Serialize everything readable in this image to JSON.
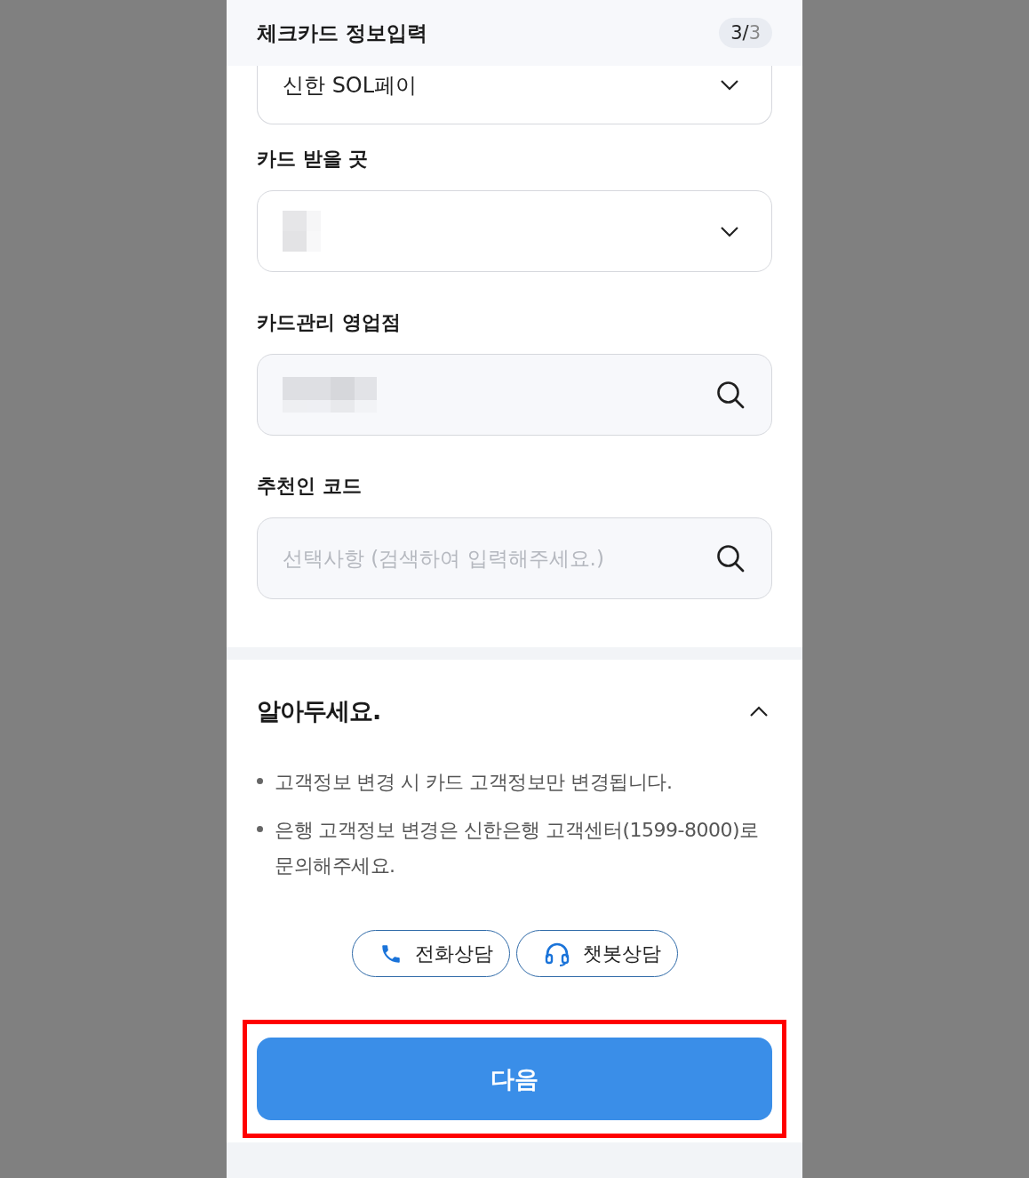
{
  "header": {
    "title": "체크카드 정보입력",
    "step_current": "3",
    "step_separator": "/",
    "step_total": "3"
  },
  "fields": [
    {
      "kind": "select",
      "value": "신한 SOL페이"
    },
    {
      "label": "카드 받을 곳",
      "kind": "select",
      "redacted": true
    },
    {
      "label": "카드관리 영업점",
      "kind": "search",
      "redacted": true
    },
    {
      "label": "추천인 코드",
      "kind": "search",
      "placeholder": "선택사항 (검색하여 입력해주세요.)"
    }
  ],
  "notice": {
    "title": "알아두세요.",
    "expanded": true,
    "items": [
      "고객정보 변경 시 카드 고객정보만 변경됩니다.",
      "은행 고객정보 변경은 신한은행 고객센터(1599-8000)로 문의해주세요."
    ]
  },
  "help_buttons": [
    {
      "kind": "phone",
      "label": "전화상담"
    },
    {
      "kind": "chatbot",
      "label": "챗봇상담"
    }
  ],
  "next_button": {
    "label": "다음"
  }
}
